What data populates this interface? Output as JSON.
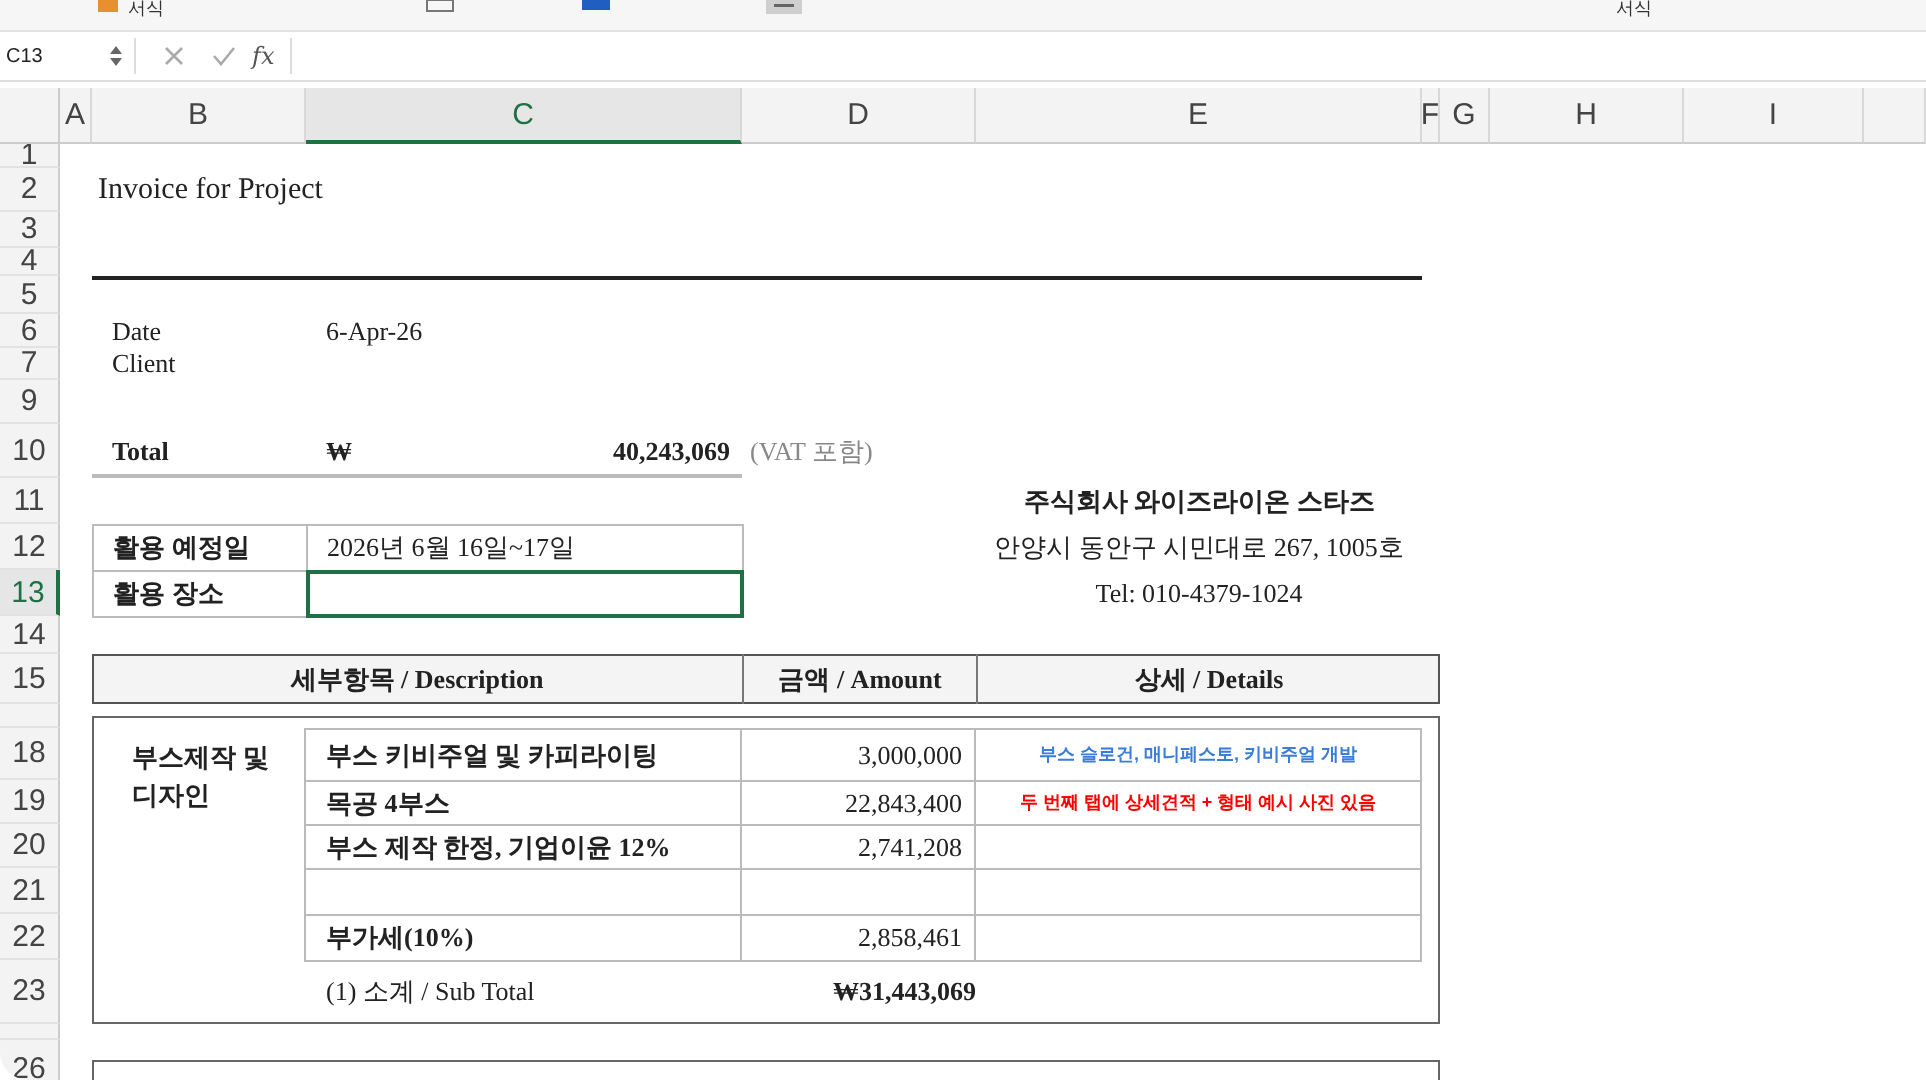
{
  "ribbon": {
    "labels": [
      "서식",
      "서식"
    ]
  },
  "formula_bar": {
    "name_box": "C13",
    "fx": "fx"
  },
  "column_headers": [
    {
      "label": "A",
      "selected": false
    },
    {
      "label": "B",
      "selected": false
    },
    {
      "label": "C",
      "selected": true
    },
    {
      "label": "D",
      "selected": false
    },
    {
      "label": "E",
      "selected": false
    },
    {
      "label": "F",
      "selected": false
    },
    {
      "label": "G",
      "selected": false
    },
    {
      "label": "H",
      "selected": false
    },
    {
      "label": "I",
      "selected": false
    }
  ],
  "row_headers": [
    {
      "label": "1",
      "selected": false
    },
    {
      "label": "2",
      "selected": false
    },
    {
      "label": "3",
      "selected": false
    },
    {
      "label": "4",
      "selected": false
    },
    {
      "label": "5",
      "selected": false
    },
    {
      "label": "6",
      "selected": false
    },
    {
      "label": "7",
      "selected": false
    },
    {
      "label": "9",
      "selected": false
    },
    {
      "label": "10",
      "selected": false
    },
    {
      "label": "11",
      "selected": false
    },
    {
      "label": "12",
      "selected": false
    },
    {
      "label": "13",
      "selected": true
    },
    {
      "label": "14",
      "selected": false
    },
    {
      "label": "15",
      "selected": false
    },
    {
      "selected": false
    },
    {
      "label": "18",
      "selected": false
    },
    {
      "label": "19",
      "selected": false
    },
    {
      "label": "20",
      "selected": false
    },
    {
      "label": "21",
      "selected": false
    },
    {
      "label": "22",
      "selected": false
    },
    {
      "label": "23",
      "selected": false
    },
    {
      "selected": false
    },
    {
      "label": "26",
      "selected": false
    }
  ],
  "invoice": {
    "title": "Invoice for Project",
    "date_label": "Date",
    "date_value": "6-Apr-26",
    "client_label": "Client",
    "total_label": "Total",
    "total_currency": "₩",
    "total_amount": "40,243,069",
    "total_note": "(VAT 포함)",
    "company": {
      "name": "주식회사 와이즈라이온 스타즈",
      "address": "안양시 동안구 시민대로 267, 1005호",
      "tel": "Tel: 010-4379-1024"
    },
    "info_rows": [
      {
        "label": "활용 예정일",
        "value": "2026년 6월 16일~17일",
        "selected": false
      },
      {
        "label": "활용 장소",
        "selected": true
      }
    ],
    "table_headers": [
      "세부항목 / Description",
      "금액 / Amount",
      "상세 / Details"
    ],
    "category": "부스제작 및 디자인",
    "items": [
      {
        "kind": "entry",
        "description": "부스 키비주얼 및 카피라이팅",
        "amount": "3,000,000",
        "details": "부스 슬로건, 매니페스토, 키비주얼 개발",
        "color": "#3b7dd8"
      },
      {
        "kind": "entry",
        "description": "목공 4부스",
        "amount": "22,843,400",
        "details": "두 번째 탭에 상세견적 + 형태 예시 사진 있음",
        "color": "#ff0000"
      },
      {
        "kind": "entry",
        "description": "부스 제작 한정, 기업이윤 12%",
        "amount": "2,741,208"
      },
      {
        "kind": "blank"
      },
      {
        "kind": "entry",
        "description": "부가세(10%)",
        "amount": "2,858,461"
      }
    ],
    "subtotal_label": "(1) 소계 / Sub Total",
    "subtotal_amount": "₩31,443,069"
  }
}
